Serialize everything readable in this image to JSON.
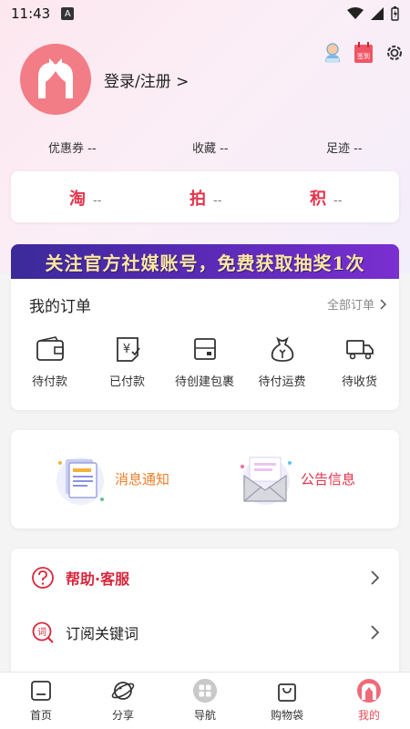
{
  "status_bar": {
    "time": "11:43",
    "notification": "A"
  },
  "header": {
    "login_label": "登录/注册 >",
    "signin_badge": "签到"
  },
  "stats": [
    {
      "label": "优惠券 --"
    },
    {
      "label": "收藏 --"
    },
    {
      "label": "足迹 --"
    }
  ],
  "points": [
    {
      "char": "淘",
      "value": "--"
    },
    {
      "char": "拍",
      "value": "--"
    },
    {
      "char": "积",
      "value": "--"
    }
  ],
  "banner": {
    "text": "关注官方社媒账号，免费获取抽奖1次"
  },
  "orders": {
    "title": "我的订单",
    "all_label": "全部订单",
    "items": [
      {
        "label": "待付款",
        "icon": "wallet-icon"
      },
      {
        "label": "已付款",
        "icon": "yen-receipt-icon"
      },
      {
        "label": "待创建包裹",
        "icon": "package-box-icon"
      },
      {
        "label": "待付运费",
        "icon": "money-bag-icon"
      },
      {
        "label": "待收货",
        "icon": "delivery-truck-icon"
      }
    ]
  },
  "notices": [
    {
      "label": "消息通知",
      "icon": "message-document-icon"
    },
    {
      "label": "公告信息",
      "icon": "announcement-envelope-icon"
    }
  ],
  "menu": [
    {
      "label": "帮助·客服",
      "icon": "help-question-icon"
    },
    {
      "label": "订阅关键词",
      "icon": "subscribe-keyword-icon"
    }
  ],
  "tabbar": [
    {
      "label": "首页",
      "icon": "home-icon",
      "active": false
    },
    {
      "label": "分享",
      "icon": "planet-share-icon",
      "active": false
    },
    {
      "label": "导航",
      "icon": "grid-navigation-icon",
      "active": false
    },
    {
      "label": "购物袋",
      "icon": "shopping-bag-icon",
      "active": false
    },
    {
      "label": "我的",
      "icon": "profile-icon",
      "active": true
    }
  ],
  "colors": {
    "accent": "#e3324a",
    "avatar": "#f27d86",
    "banner": "#4a2aa8",
    "notice_orange": "#ee7f2a"
  }
}
